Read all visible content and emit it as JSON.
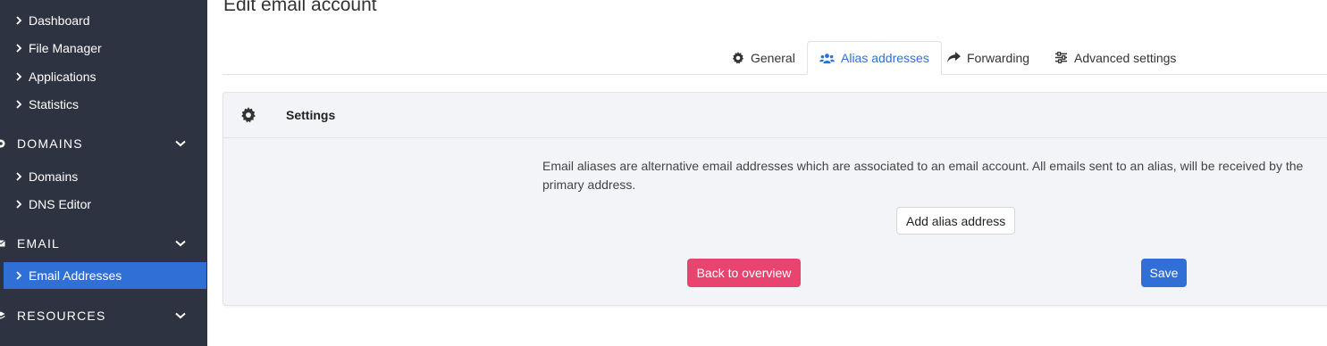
{
  "sidebar": {
    "items_top": [
      {
        "label": "Dashboard"
      },
      {
        "label": "File Manager"
      },
      {
        "label": "Applications"
      },
      {
        "label": "Statistics"
      }
    ],
    "domains_section": {
      "label": "DOMAINS"
    },
    "domains_items": [
      {
        "label": "Domains"
      },
      {
        "label": "DNS Editor"
      }
    ],
    "email_section": {
      "label": "EMAIL"
    },
    "email_items": [
      {
        "label": "Email Addresses",
        "active": true
      }
    ],
    "resources_section": {
      "label": "RESOURCES"
    }
  },
  "page": {
    "title": "Edit email account"
  },
  "tabs": [
    {
      "label": "General",
      "icon": "gear-icon"
    },
    {
      "label": "Alias addresses",
      "icon": "users-icon",
      "active": true
    },
    {
      "label": "Forwarding",
      "icon": "share-arrow-icon"
    },
    {
      "label": "Advanced settings",
      "icon": "sliders-icon"
    }
  ],
  "card": {
    "header_title": "Settings",
    "description": "Email aliases are alternative email addresses which are associated to an email account. All emails sent to an alias, will be received by the primary address.",
    "add_alias_label": "Add alias address",
    "back_label": "Back to overview",
    "save_label": "Save"
  },
  "colors": {
    "sidebar_bg": "#2d3340",
    "active_blue": "#2f6fd6",
    "back_button": "#e8446f",
    "card_bg": "#f3f4f8"
  }
}
